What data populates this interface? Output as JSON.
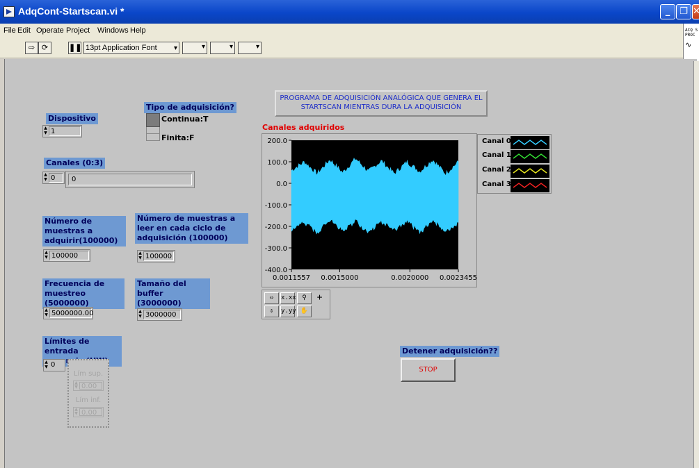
{
  "window": {
    "title": "AdqCont-Startscan.vi *"
  },
  "menu": [
    "File",
    "Edit",
    "Operate",
    "Project",
    "Windows",
    "Help"
  ],
  "toolbar": {
    "font_select": "13pt Application Font"
  },
  "side_icons": {
    "line1": "ACQ S",
    "line2": "PROC"
  },
  "panel": {
    "banner": "PROGRAMA DE ADQUISICIÓN ANALÓGICA QUE GENERA EL STARTSCAN MIENTRAS DURA LA ADQUISICIÓN",
    "dispositivo": {
      "label": "Dispositivo",
      "value": "1"
    },
    "tipo": {
      "label": "Tipo de adquisición?",
      "on": "Continua:T",
      "off": "Finita:F"
    },
    "canales": {
      "label": "Canales (0:3)",
      "index": "0",
      "value": "0"
    },
    "num_muestras": {
      "label": "Número de muestras a adquirir(100000)",
      "value": "100000"
    },
    "num_leer": {
      "label": "Número de muestras a leer en cada ciclo de adquisición (100000)",
      "value": "100000"
    },
    "frecuencia": {
      "label": "Frecuencia de muestreo (5000000)",
      "value": "5000000.00"
    },
    "buffer": {
      "label": "Tamaño del buffer (3000000)",
      "value": "3000000"
    },
    "limites": {
      "label": "Límites de entrada ganancia (HW)",
      "index": "0",
      "sup_label": "Lím sup.",
      "sup_value": "0.00",
      "inf_label": "Lím inf.",
      "inf_value": "0.00"
    },
    "stop": {
      "label": "Detener adquisición??",
      "button": "STOP"
    }
  },
  "chart_data": {
    "type": "line",
    "title": "Canales adquiridos",
    "xlabel": "",
    "ylabel": "",
    "xlim": [
      0.0011557,
      0.0023455
    ],
    "ylim": [
      -400,
      200
    ],
    "x_tick_labels": [
      "0.0011557",
      "0.0015000",
      "0.0020000",
      "0.0023455"
    ],
    "x_ticks": [
      0.0011557,
      0.0015,
      0.002,
      0.0023455
    ],
    "y_ticks": [
      200,
      100,
      0,
      -100,
      -200,
      -300,
      -400
    ],
    "y_tick_labels": [
      "200.0",
      "100.0",
      "0.0",
      "-100.0",
      "-200.0",
      "-300.0",
      "-400.0"
    ],
    "background": "#000000",
    "series": [
      {
        "name": "Canal 0",
        "color": "#33ccff",
        "upper_envelope": [
          55,
          95,
          40,
          105,
          45,
          110,
          50,
          100,
          40,
          95,
          50,
          105,
          40,
          95
        ],
        "lower_envelope": [
          -215,
          -175,
          -225,
          -165,
          -215,
          -170,
          -225,
          -175,
          -215,
          -170,
          -225,
          -165,
          -215,
          -180
        ]
      },
      {
        "name": "Canal 1",
        "color": "#33dd33"
      },
      {
        "name": "Canal 2",
        "color": "#e8e820"
      },
      {
        "name": "Canal 3",
        "color": "#ee2222"
      }
    ]
  }
}
